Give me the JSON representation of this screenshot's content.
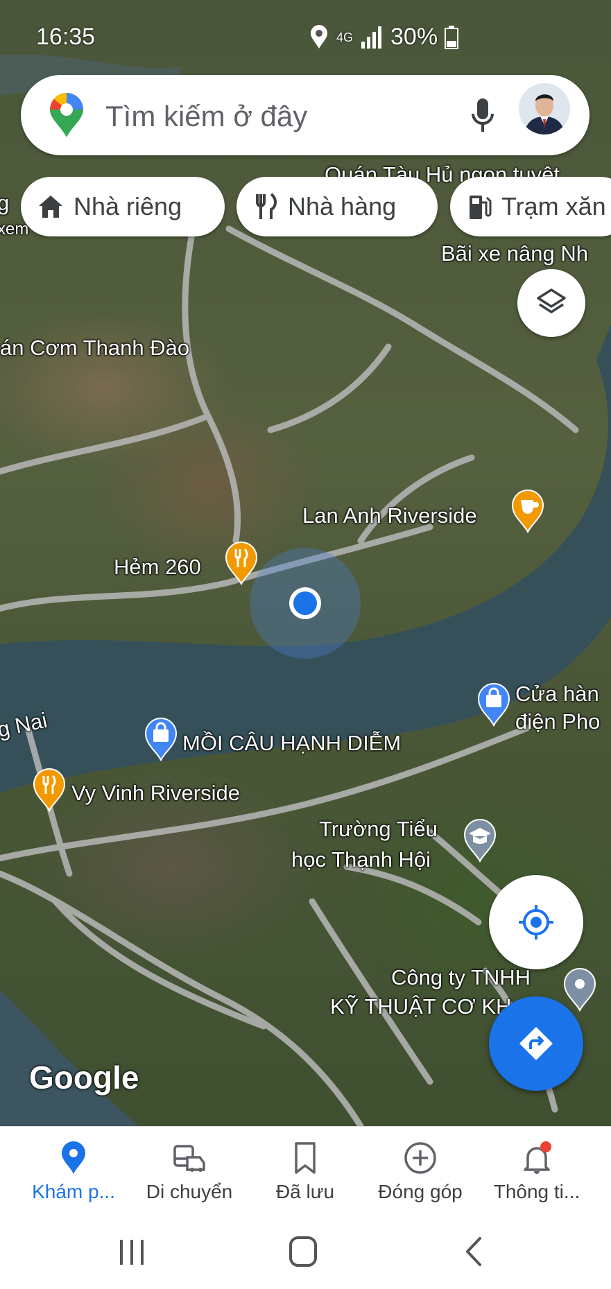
{
  "status_bar": {
    "time": "16:35",
    "network": "4G",
    "battery": "30%"
  },
  "search": {
    "placeholder": "Tìm kiếm ở đây"
  },
  "chips": [
    {
      "label": "Nhà riêng",
      "icon": "home-icon"
    },
    {
      "label": "Nhà hàng",
      "icon": "restaurant-icon"
    },
    {
      "label": "Trạm xăn",
      "icon": "gas-station-icon"
    }
  ],
  "map_labels": {
    "quan_tau_hu": "Quán Tàu Hủ ngon tuyệt",
    "bai_xe": "Bãi xe nâng Nh",
    "com_thanh_dao": "án Cơm Thanh Đào",
    "lan_anh": "Lan Anh Riverside",
    "hem_260": "Hẻm 260",
    "song_nai": "g Nai",
    "moi_cau": "MỒI CÂU HẠNH DIỄM",
    "cua_hang_1": "Cửa hàn",
    "cua_hang_2": "điện Pho",
    "vy_vinh": "Vy Vinh Riverside",
    "truong_1": "Trường Tiểu",
    "truong_2": "học Thạnh Hội",
    "cong_ty_1": "Công ty TNHH",
    "cong_ty_2": "KỸ THUẬT CƠ KH",
    "left_edge_1": "g",
    "left_edge_2": "xem"
  },
  "branding": {
    "google": "Google"
  },
  "bottom_nav": [
    {
      "label": "Khám p...",
      "icon": "explore-pin-icon",
      "active": true
    },
    {
      "label": "Di chuyển",
      "icon": "commute-icon",
      "active": false
    },
    {
      "label": "Đã lưu",
      "icon": "bookmark-icon",
      "active": false
    },
    {
      "label": "Đóng góp",
      "icon": "add-circle-icon",
      "active": false
    },
    {
      "label": "Thông ti...",
      "icon": "notification-bell-icon",
      "active": false
    }
  ],
  "colors": {
    "accent": "#1a73e8",
    "restaurant_pin": "#f29900",
    "shopping_pin": "#4285f4",
    "school_pin": "#7d8fa3",
    "notification_dot": "#ea4335"
  }
}
